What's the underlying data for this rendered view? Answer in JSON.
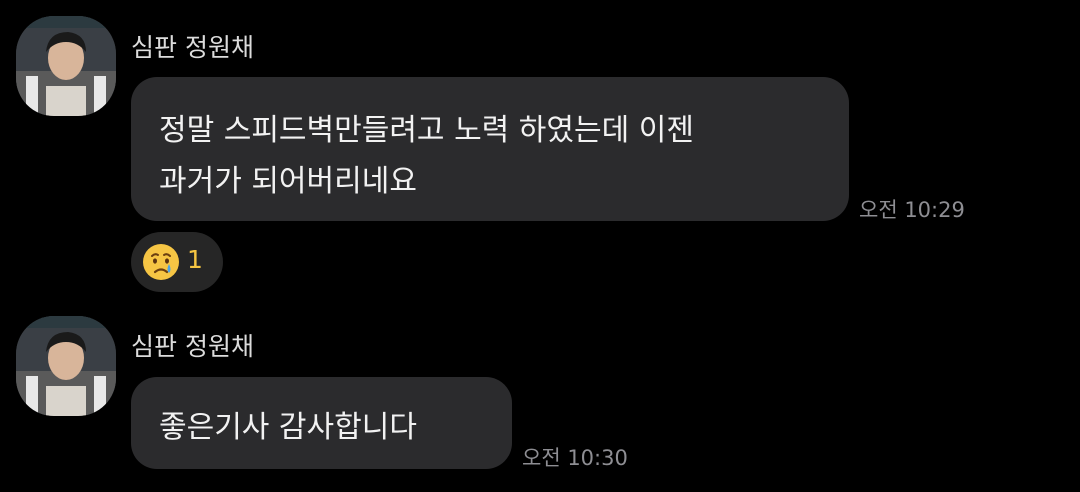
{
  "messages": [
    {
      "sender": "심판 정원채",
      "lines": [
        "정말 스피드벽만들려고 노력 하였는데 이젠",
        "과거가 되어버리네요"
      ],
      "time": "오전 10:29",
      "reaction": {
        "icon": "sad-crying-face-icon",
        "count": "1"
      }
    },
    {
      "sender": "심판 정원채",
      "lines": [
        "좋은기사 감사합니다"
      ],
      "time": "오전 10:30"
    }
  ],
  "colors": {
    "background": "#000000",
    "bubble": "#2b2b2d",
    "reaction_count": "#f5c542",
    "timestamp": "#8e8e93"
  }
}
